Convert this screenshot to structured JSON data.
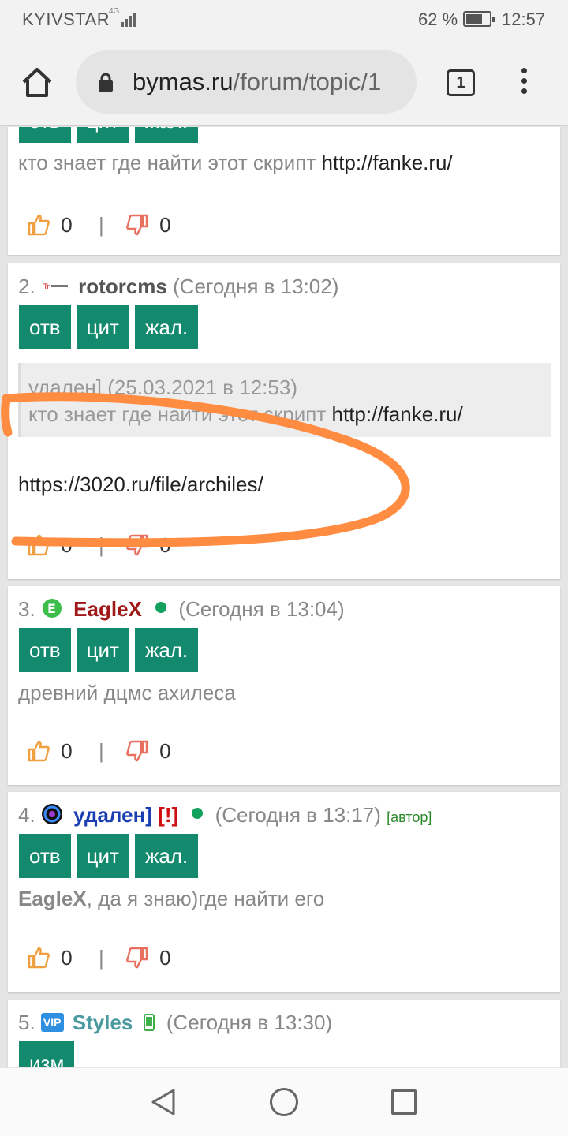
{
  "status_bar": {
    "carrier": "KYIVSTAR",
    "network": "4G",
    "battery": "62 %",
    "time": "12:57"
  },
  "browser": {
    "url_host": "bymas.ru",
    "url_path": "/forum/topic/1",
    "tab_count": "1"
  },
  "buttons": {
    "reply": "отв",
    "quote": "цит",
    "report": "жал.",
    "edit": "изм"
  },
  "posts": [
    {
      "text": "кто знает где найти этот скрипт",
      "link": "http://fanke.ru/",
      "likes": "0",
      "dislikes": "0"
    },
    {
      "num": "2.",
      "author": "rotorcms",
      "time": "(Сегодня в 13:02)",
      "quote_header": "удален] (25.03.2021 в 12:53)",
      "quote_text": "кто знает где найти этот скрипт",
      "quote_link": "http://fanke.ru/",
      "text": "https://3020.ru/file/archiles/",
      "likes": "0",
      "dislikes": "0"
    },
    {
      "num": "3.",
      "author": "EagleX",
      "time": "(Сегодня в 13:04)",
      "text": "древний дцмс ахилеса",
      "likes": "0",
      "dislikes": "0"
    },
    {
      "num": "4.",
      "author": "удален]",
      "warn": "[!]",
      "time": "(Сегодня в 13:17)",
      "author_badge": "[автор]",
      "mention": "EagleX",
      "text": ", да я знаю)где найти его",
      "likes": "0",
      "dislikes": "0"
    },
    {
      "num": "5.",
      "author": "Styles",
      "time": "(Сегодня в 13:30)",
      "badge": "VIP"
    }
  ],
  "colors": {
    "button_green": "#13896e",
    "scribble_orange": "#ff8c40",
    "eaglex_red": "#a01818",
    "author_blue": "#1a3fb0",
    "styles_teal": "#4a9aa0"
  }
}
